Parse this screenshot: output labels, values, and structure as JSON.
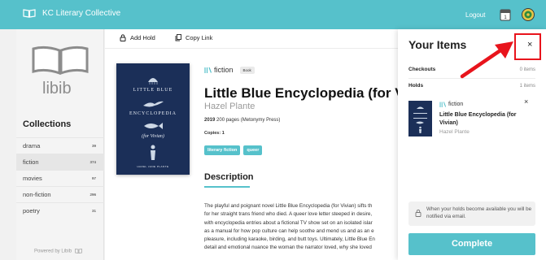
{
  "header": {
    "brand": "KC Literary Collective",
    "logout": "Logout",
    "calendar_badge": "1"
  },
  "sidebar": {
    "logo_text": "libib",
    "collections_title": "Collections",
    "collections": [
      {
        "name": "drama",
        "count": "39"
      },
      {
        "name": "fiction",
        "count": "374"
      },
      {
        "name": "movies",
        "count": "97"
      },
      {
        "name": "non-fiction",
        "count": "296"
      },
      {
        "name": "poetry",
        "count": "31"
      }
    ],
    "powered_by": "Powered by Libib"
  },
  "toolbar": {
    "add_hold": "Add Hold",
    "copy_link": "Copy Link"
  },
  "book": {
    "cover": {
      "line1": "LITTLE BLUE",
      "line2": "ENCYCLOPEDIA",
      "line3": "(for Vivian)",
      "author_line": "HAZEL JANE PLANTE"
    },
    "genre": "fiction",
    "format_badge": "Book",
    "title": "Little Blue Encyclopedia (for Vivi",
    "author": "Hazel Plante",
    "year": "2019",
    "pages": "200 pages",
    "publisher": "(Metonymy Press)",
    "copies": "Copies: 1",
    "tags": [
      "literary fiction",
      "queer"
    ],
    "description_title": "Description",
    "description_lines": [
      "The playful and poignant novel Little Blue Encyclopedia (for Vivian) sifts th",
      "for her straight trans friend who died. A queer love letter steeped in desire,",
      "with encyclopedia entries about a fictional TV show set on an isolated islar",
      "as a manual for how pop culture can help soothe and mend us and as an e",
      "pleasure, including karaoke, birding, and butt toys. Ultimately, Little Blue En",
      "detail and emotional nuance the woman the narrator loved, why she loved"
    ]
  },
  "panel": {
    "title": "Your Items",
    "close": "×",
    "checkouts_label": "Checkouts",
    "checkouts_count": "0 items",
    "holds_label": "Holds",
    "holds_count": "1 items",
    "hold_item": {
      "genre": "fiction",
      "title": "Little Blue Encyclopedia (for Vivian)",
      "author": "Hazel Plante",
      "remove": "×"
    },
    "notice": "When your holds become available you will be notified via email.",
    "complete_button": "Complete"
  },
  "colors": {
    "accent": "#56c1cb",
    "cover_navy": "#1b2f58",
    "highlight_red": "#e8141c"
  }
}
